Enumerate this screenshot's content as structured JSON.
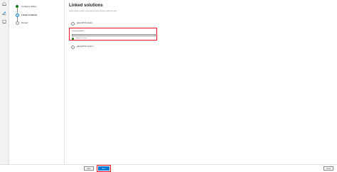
{
  "rail": {
    "items": [
      {
        "label": "Home",
        "icon": "home-icon"
      },
      {
        "label": "All Apps",
        "icon": "apps-icon"
      },
      {
        "label": "Demo",
        "icon": "grid-icon"
      }
    ]
  },
  "steps": [
    {
      "label": "Configure Gallery",
      "state": "done"
    },
    {
      "label": "Linked solutions",
      "state": "current"
    },
    {
      "label": "Review",
      "state": "todo"
    }
  ],
  "main": {
    "title": "Linked solutions",
    "description": "Define solution product associated to all the solutions under this store",
    "options": [
      {
        "label": "galaxyDTSS solution"
      },
      {
        "label": "galaxyDTSS solution v"
      }
    ],
    "selected_group": {
      "label": "SmartTaxpayable *",
      "value": "",
      "status_label": "Added in solutn"
    }
  },
  "footer": {
    "back_label": "Back",
    "next_label": "Next",
    "close_label": "Close"
  },
  "colors": {
    "accent": "#0078d4",
    "highlight": "#e81123",
    "done": "#107c10"
  }
}
